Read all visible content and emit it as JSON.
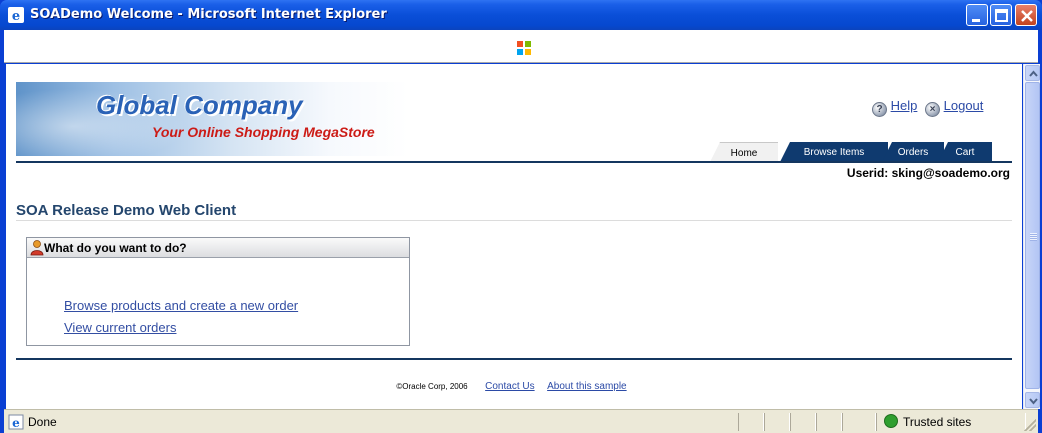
{
  "window": {
    "title": "SOADemo Welcome - Microsoft Internet Explorer"
  },
  "header": {
    "company_name": "Global Company",
    "tagline": "Your Online Shopping MegaStore",
    "help_label": "Help",
    "logout_label": "Logout",
    "userid_label": "Userid: sking@soademo.org"
  },
  "tabs": [
    {
      "label": "Home",
      "selected": true
    },
    {
      "label": "Browse Items",
      "selected": false
    },
    {
      "label": "Orders",
      "selected": false
    },
    {
      "label": "Cart",
      "selected": false
    }
  ],
  "main": {
    "page_title": "SOA Release Demo Web Client",
    "panel_title": "What do you want to do?",
    "links": [
      "Browse products and create a new order",
      "View current orders"
    ]
  },
  "footer": {
    "copyright": "©Oracle Corp, 2006",
    "contact_label": "Contact Us",
    "about_label": "About this sample"
  },
  "statusbar": {
    "status_text": "Done",
    "zone_text": "Trusted sites"
  },
  "icons": {
    "help": "help-icon",
    "logout": "logout-icon",
    "person": "person-icon",
    "ie": "ie-icon",
    "zone": "trusted-sites-icon"
  },
  "colors": {
    "titlebar": "#0a4fd8",
    "nav_tab": "#0f3a6f",
    "link": "#2b4aa6",
    "tagline": "#cc1b16",
    "company": "#2a62b6"
  }
}
